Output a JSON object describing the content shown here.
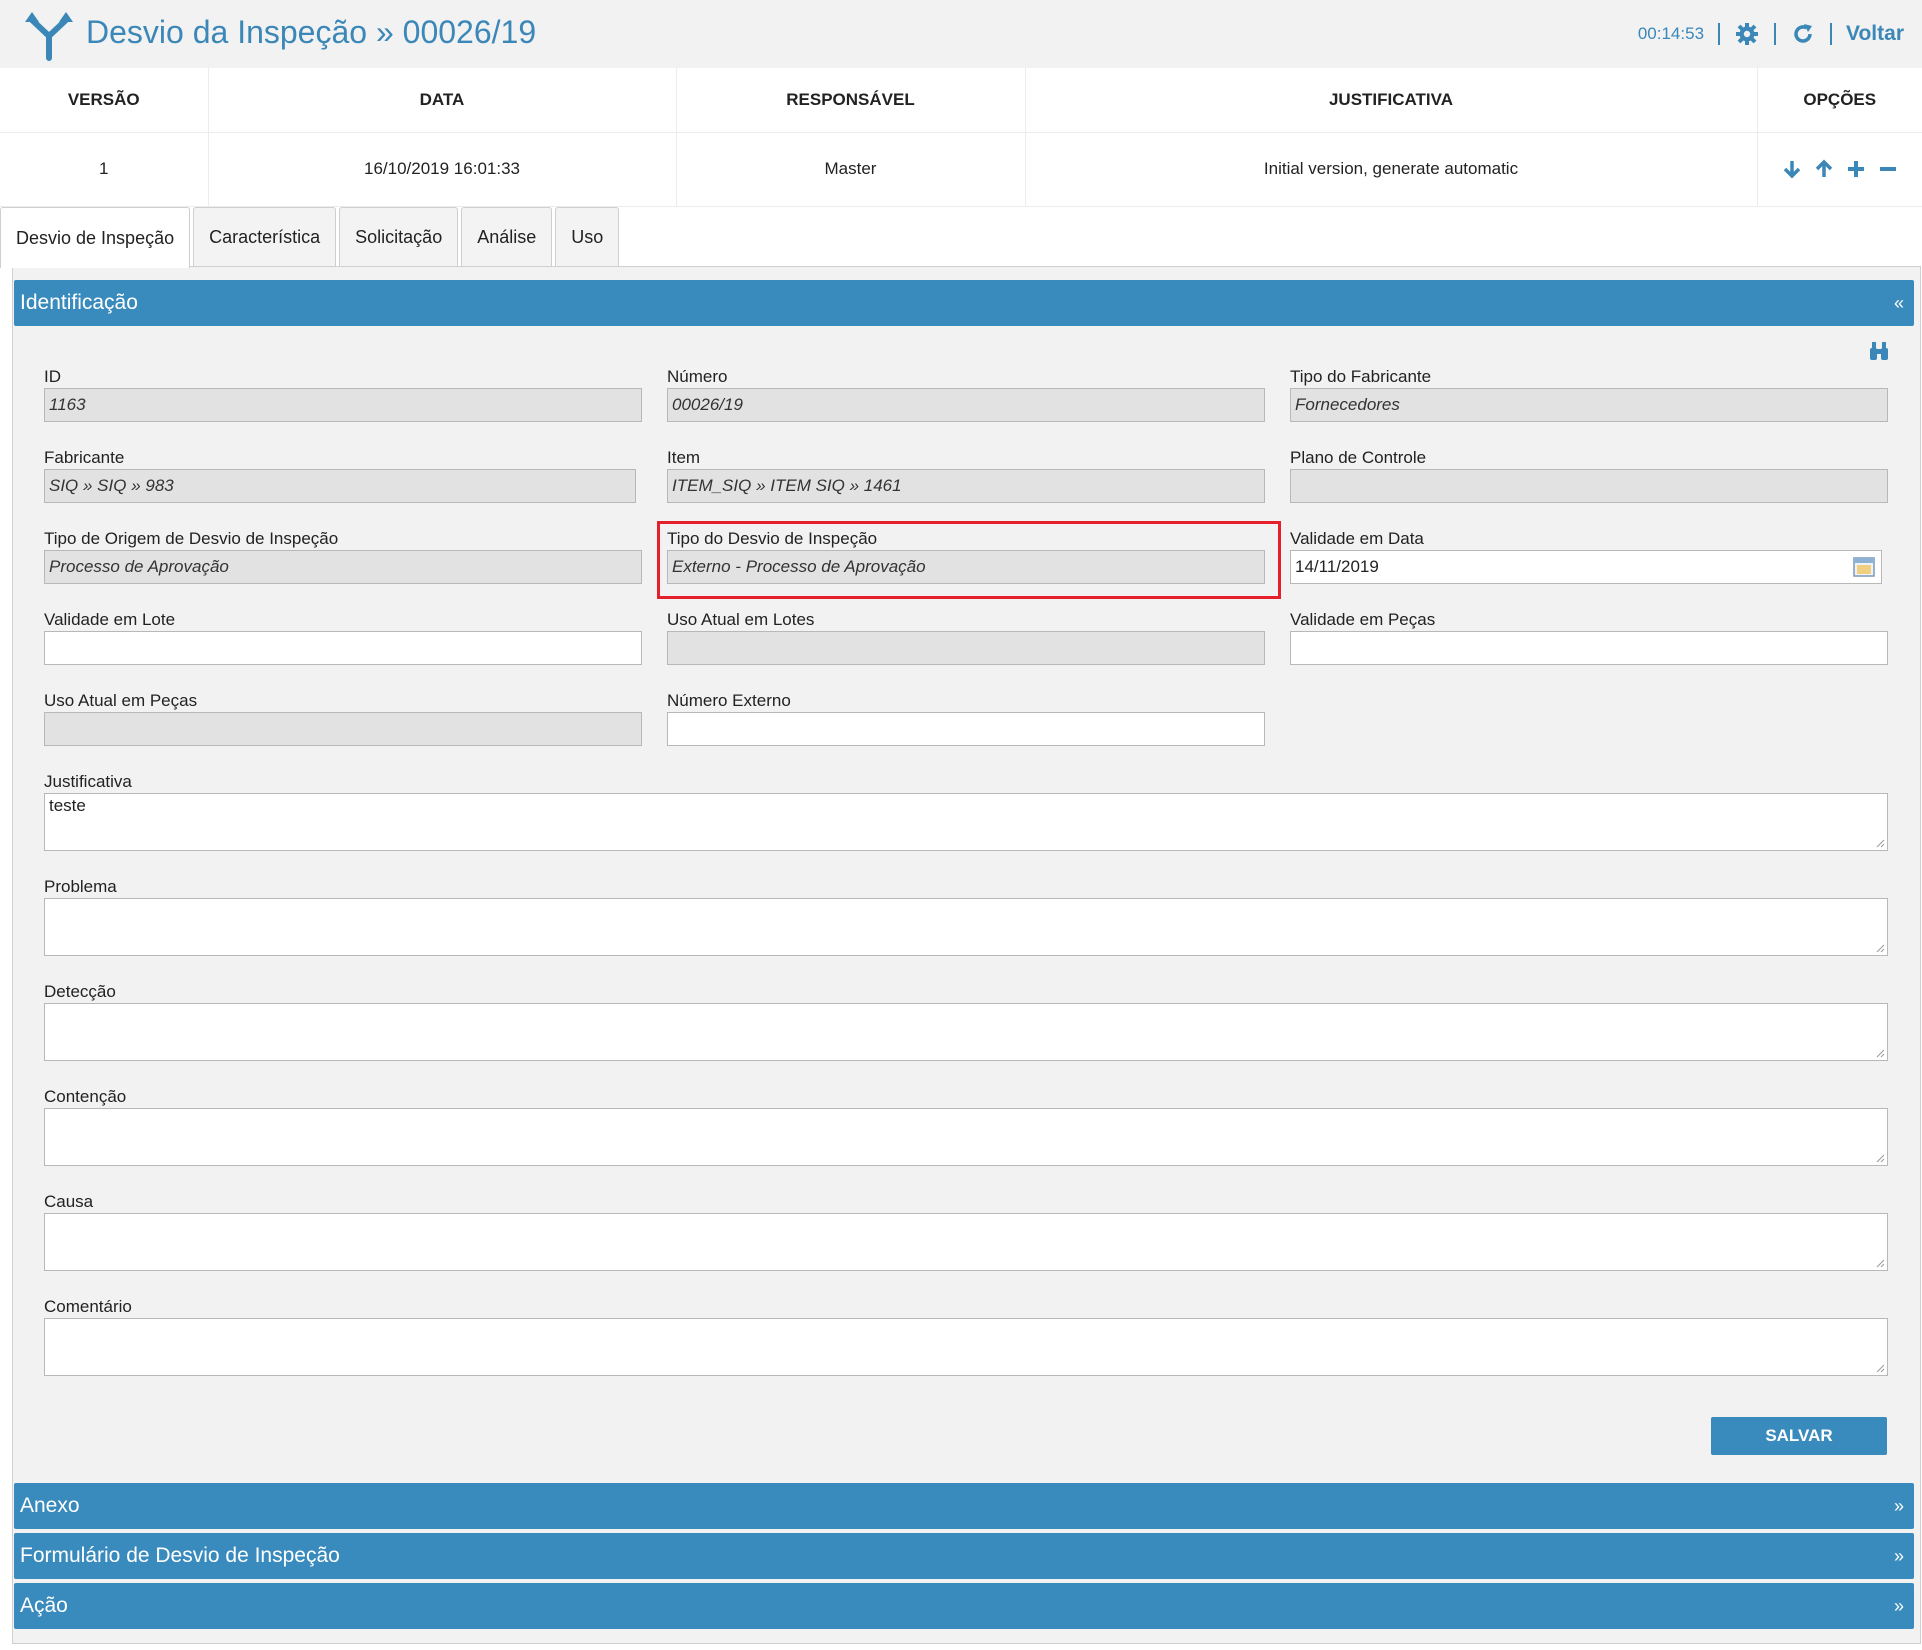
{
  "header": {
    "title": "Desvio da Inspeção » 00026/19",
    "timer": "00:14:53",
    "back_label": "Voltar"
  },
  "colors": {
    "accent": "#3a8bbd",
    "highlight": "#e4202b",
    "readonly_bg": "#e2e2e2"
  },
  "version_table": {
    "headers": [
      "VERSÃO",
      "DATA",
      "RESPONSÁVEL",
      "JUSTIFICATIVA",
      "OPÇÕES"
    ],
    "rows": [
      {
        "version": "1",
        "date": "16/10/2019 16:01:33",
        "responsible": "Master",
        "justification": "Initial version, generate automatic"
      }
    ],
    "option_icons": [
      "arrow-down-icon",
      "arrow-up-icon",
      "plus-icon",
      "minus-icon"
    ]
  },
  "tabs": [
    "Desvio de Inspeção",
    "Característica",
    "Solicitação",
    "Análise",
    "Uso"
  ],
  "sections": {
    "identification": "Identificação",
    "attachment": "Anexo",
    "form": "Formulário de Desvio de Inspeção",
    "action": "Ação",
    "collapse_glyph": "«",
    "expand_glyph": "»"
  },
  "form": {
    "id": {
      "label": "ID",
      "value": "1163"
    },
    "number": {
      "label": "Número",
      "value": "00026/19"
    },
    "manufacturer_type": {
      "label": "Tipo do Fabricante",
      "value": "Fornecedores"
    },
    "manufacturer": {
      "label": "Fabricante",
      "value": "SIQ » SIQ » 983"
    },
    "item": {
      "label": "Item",
      "value": "ITEM_SIQ » ITEM SIQ » 1461"
    },
    "control_plan": {
      "label": "Plano de Controle",
      "value": ""
    },
    "origin_type": {
      "label": "Tipo de Origem de Desvio de Inspeção",
      "value": "Processo de Aprovação"
    },
    "deviation_type": {
      "label": "Tipo do Desvio de Inspeção",
      "value": "Externo - Processo de Aprovação"
    },
    "validity_date": {
      "label": "Validade em Data",
      "value": "14/11/2019"
    },
    "validity_lot": {
      "label": "Validade em Lote",
      "value": ""
    },
    "current_use_lots": {
      "label": "Uso Atual em Lotes",
      "value": ""
    },
    "validity_pieces": {
      "label": "Validade em Peças",
      "value": ""
    },
    "current_use_pieces": {
      "label": "Uso Atual em Peças",
      "value": ""
    },
    "external_number": {
      "label": "Número Externo",
      "value": ""
    },
    "justification": {
      "label": "Justificativa",
      "value": "teste"
    },
    "problem": {
      "label": "Problema",
      "value": ""
    },
    "detection": {
      "label": "Detecção",
      "value": ""
    },
    "containment": {
      "label": "Contenção",
      "value": ""
    },
    "cause": {
      "label": "Causa",
      "value": ""
    },
    "comment": {
      "label": "Comentário",
      "value": ""
    },
    "save_label": "SALVAR"
  }
}
